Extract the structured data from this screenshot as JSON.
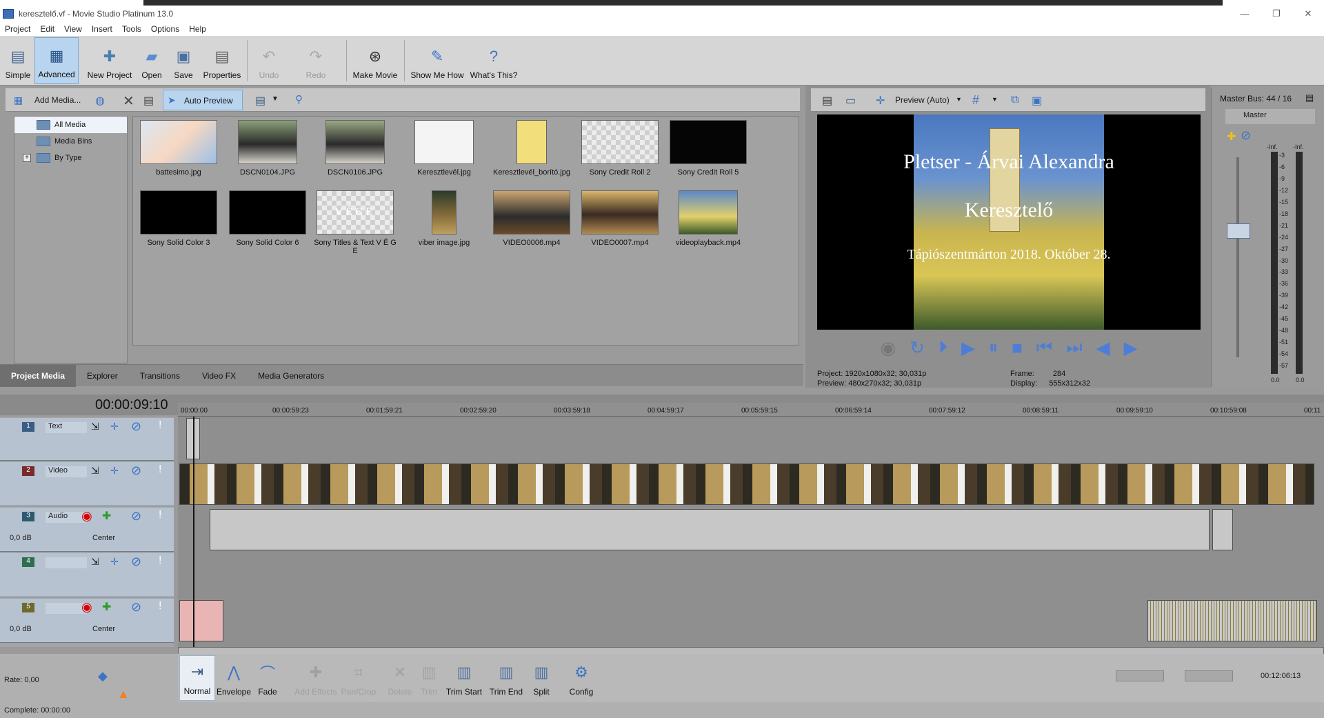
{
  "window": {
    "title": "keresztelő.vf - Movie Studio Platinum 13.0",
    "controls": [
      "—",
      "❐",
      "✕"
    ]
  },
  "menu": [
    "Project",
    "Edit",
    "View",
    "Insert",
    "Tools",
    "Options",
    "Help"
  ],
  "toolbar": {
    "simple": "Simple",
    "advanced": "Advanced",
    "new_project": "New Project",
    "open": "Open",
    "save": "Save",
    "properties": "Properties",
    "undo": "Undo",
    "redo": "Redo",
    "make_movie": "Make Movie",
    "show_me_how": "Show Me How",
    "whats_this": "What's This?"
  },
  "media_toolbar": {
    "add_media": "Add Media...",
    "auto_preview": "Auto Preview"
  },
  "tree": [
    "All Media",
    "Media Bins",
    "By Type"
  ],
  "media": [
    {
      "name": "battesimo.jpg"
    },
    {
      "name": "DSCN0104.JPG"
    },
    {
      "name": "DSCN0106.JPG"
    },
    {
      "name": "Keresztlevél.jpg"
    },
    {
      "name": "Keresztlevél_borító.jpg"
    },
    {
      "name": "Sony Credit Roll 2"
    },
    {
      "name": "Sony Credit Roll 5"
    },
    {
      "name": "Sony Solid Color 3"
    },
    {
      "name": "Sony Solid Color 6"
    },
    {
      "name": "Sony Titles & Text V É G E",
      "overlay": "VÉGE"
    },
    {
      "name": "viber image.jpg"
    },
    {
      "name": "VIDEO0006.mp4"
    },
    {
      "name": "VIDEO0007.mp4"
    },
    {
      "name": "videoplayback.mp4"
    }
  ],
  "tabs": [
    "Project Media",
    "Explorer",
    "Transitions",
    "Video FX",
    "Media Generators"
  ],
  "preview": {
    "mode": "Preview (Auto)",
    "line1": "Pletser - Árvai Alexandra",
    "line2": "Keresztelő",
    "line3": "Tápiószentmárton 2018. Október 28.",
    "project_label": "Project:",
    "project_value": "1920x1080x32; 30,031p",
    "preview_label": "Preview:",
    "preview_value": "480x270x32; 30,031p",
    "frame_label": "Frame:",
    "frame_value": "284",
    "display_label": "Display:",
    "display_value": "555x312x32"
  },
  "mixer": {
    "title": "Master Bus: 44 / 16",
    "master": "Master",
    "inf": "-Inf.",
    "scale": [
      "3",
      "6",
      "9",
      "12",
      "15",
      "18",
      "21",
      "24",
      "27",
      "30",
      "33",
      "36",
      "39",
      "42",
      "45",
      "48",
      "51",
      "54",
      "57"
    ],
    "zero": "0.0"
  },
  "timeline": {
    "time": "00:00:09:10",
    "ruler": [
      "00:00:00",
      "00:00:59:23",
      "00:01:59:21",
      "00:02:59:20",
      "00:03:59:18",
      "00:04:59:17",
      "00:05:59:15",
      "00:06:59:14",
      "00:07:59:12",
      "00:08:59:11",
      "00:09:59:10",
      "00:10:59:08",
      "00:11"
    ],
    "tracks": [
      {
        "num": "1",
        "name": "Text"
      },
      {
        "num": "2",
        "name": "Video"
      },
      {
        "num": "3",
        "name": "Audio",
        "db": "0,0 dB",
        "pan": "Center"
      },
      {
        "num": "4",
        "name": ""
      },
      {
        "num": "5",
        "name": "",
        "db": "0,0 dB",
        "pan": "Center"
      }
    ],
    "end_time": "00:12:06:13",
    "rate": "Rate: 0,00"
  },
  "edit_tools": {
    "normal": "Normal",
    "envelope": "Envelope",
    "fade": "Fade",
    "add_effects": "Add Effects",
    "pan_crop": "Pan/Crop",
    "delete": "Delete",
    "trim": "Trim",
    "trim_start": "Trim Start",
    "trim_end": "Trim End",
    "split": "Split",
    "config": "Config"
  },
  "status": "Complete: 00:00:00"
}
